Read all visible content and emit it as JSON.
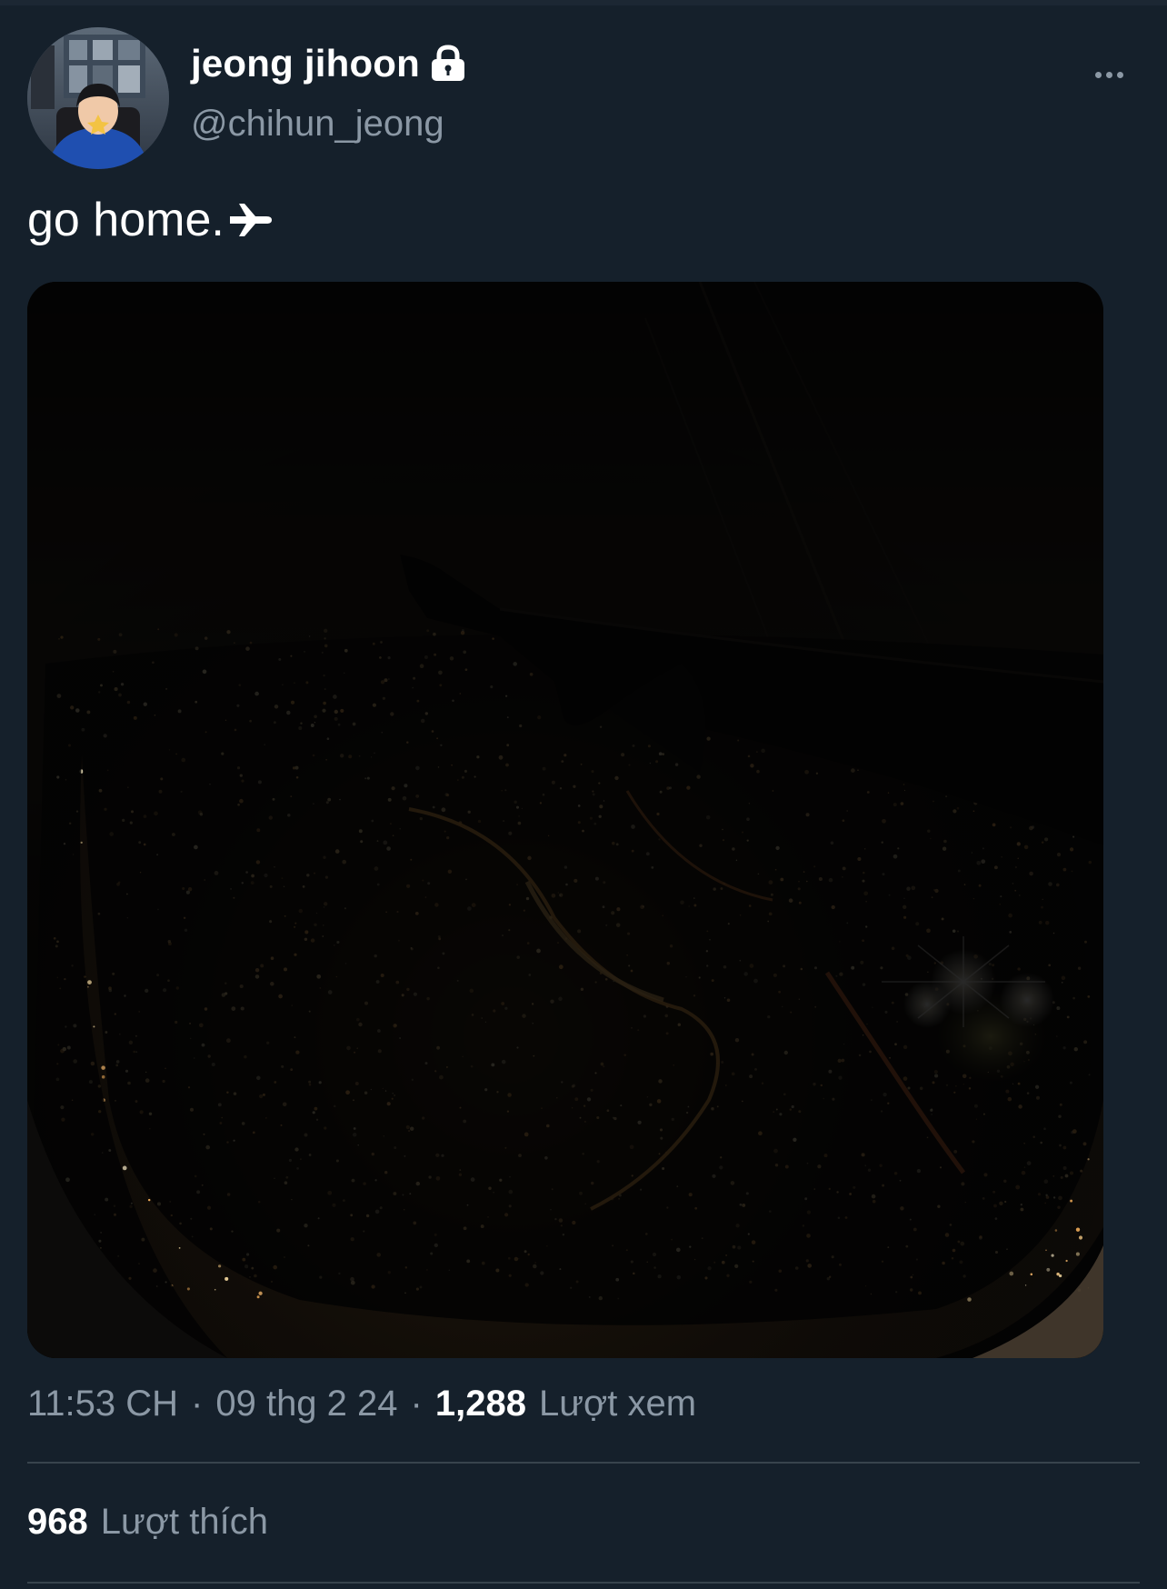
{
  "tweet": {
    "author": {
      "display_name": "jeong jihoon",
      "handle": "@chihun_jeong",
      "protected_icon": "lock-icon"
    },
    "more_icon": "more-horizontal-icon",
    "text": "go home.",
    "text_emoji": "airplane-icon",
    "media": {
      "description_icon": "photo"
    },
    "time": "11:53 CH",
    "date": "09 thg 2 24",
    "separator": "·",
    "views_count": "1,288",
    "views_label": "Lượt xem",
    "likes_count": "968",
    "likes_label": "Lượt thích"
  },
  "colors": {
    "background": "#15202b",
    "text_primary": "#ffffff",
    "text_secondary": "#8b98a5",
    "divider": "#38444d"
  }
}
